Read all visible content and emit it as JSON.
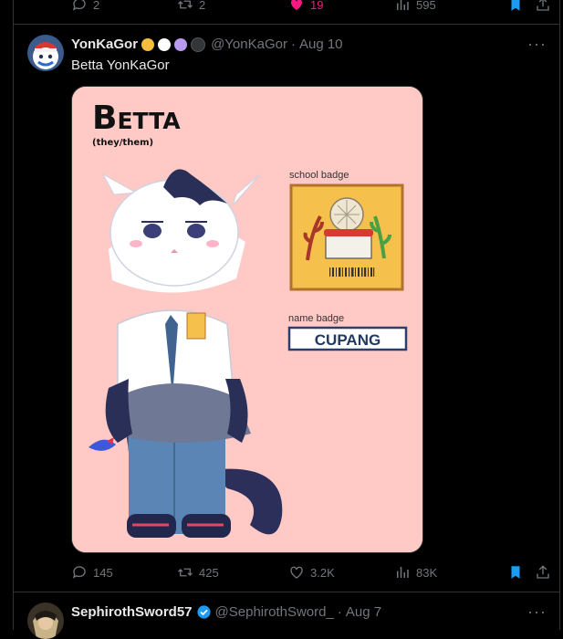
{
  "prev_tweet": {
    "replies": "2",
    "retweets": "2",
    "likes": "19",
    "views": "595",
    "like_color": "#f91880",
    "bookmark_color": "#1d9bf0"
  },
  "tweet": {
    "display_name": "YonKaGor",
    "hearts": [
      "#f4bd3b",
      "#ffffff",
      "#b79af0",
      "#333639"
    ],
    "handle": "@YonKaGor",
    "separator": "·",
    "date": "Aug 10",
    "more": "···",
    "text": "Betta YonKaGor",
    "media": {
      "title": "Betta",
      "pronouns": "(they/them)",
      "school_badge_label": "school badge",
      "name_badge_label": "name badge",
      "name_badge_text": "CUPANG",
      "background": "#ffc9c6"
    },
    "replies": "145",
    "retweets": "425",
    "likes": "3.2K",
    "views": "83K"
  },
  "next_tweet": {
    "display_name": "SephirothSword57",
    "handle": "@SephirothSword_",
    "separator": "·",
    "date": "Aug 7",
    "more": "···",
    "verified_color": "#1d9bf0"
  }
}
